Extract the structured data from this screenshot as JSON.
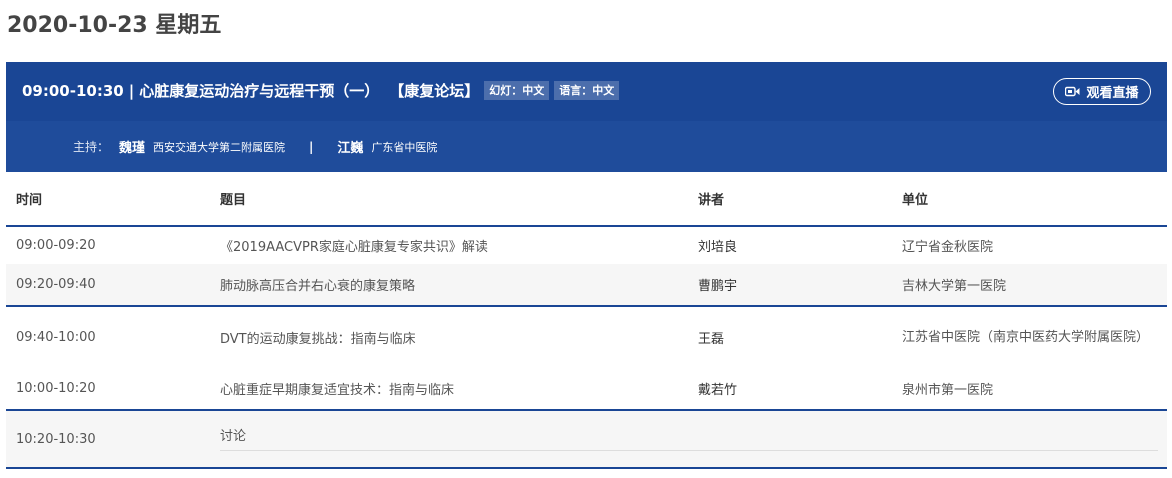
{
  "date_title": "2020-10-23 星期五",
  "session": {
    "time": "09:00-10:30",
    "separator": "|",
    "name": "心脏康复运动治疗与远程干预（一）",
    "forum": "【康复论坛】",
    "slides_tag": "幻灯：中文",
    "language_tag": "语言：中文",
    "watch_button": "观看直播",
    "hosts_label": "主持：",
    "hosts": [
      {
        "name": "魏瑾",
        "org": "西安交通大学第二附属医院"
      },
      {
        "name": "江巍",
        "org": "广东省中医院"
      }
    ],
    "hosts_separator": "|"
  },
  "table": {
    "headers": [
      "时间",
      "题目",
      "讲者",
      "单位"
    ],
    "rows": [
      {
        "time": "09:00-09:20",
        "topic": "《2019AACVPR家庭心脏康复专家共识》解读",
        "speaker": "刘培良",
        "unit": "辽宁省金秋医院"
      },
      {
        "time": "09:20-09:40",
        "topic": "肺动脉高压合并右心衰的康复策略",
        "speaker": "曹鹏宇",
        "unit": "吉林大学第一医院"
      },
      {
        "time": "09:40-10:00",
        "topic": "DVT的运动康复挑战：指南与临床",
        "speaker": "王磊",
        "unit": "江苏省中医院（南京中医药大学附属医院）"
      },
      {
        "time": "10:00-10:20",
        "topic": "心脏重症早期康复适宜技术：指南与临床",
        "speaker": "戴若竹",
        "unit": "泉州市第一医院"
      },
      {
        "time": "10:20-10:30",
        "topic": "讨论",
        "speaker": "",
        "unit": ""
      }
    ]
  },
  "colors": {
    "header_bg": "#1a4695",
    "hosts_bg": "#1f4c9b",
    "divider": "#1a4695",
    "stripe": "#f6f6f6"
  },
  "icons": {
    "watch_button_icon": "video-camera-icon"
  }
}
